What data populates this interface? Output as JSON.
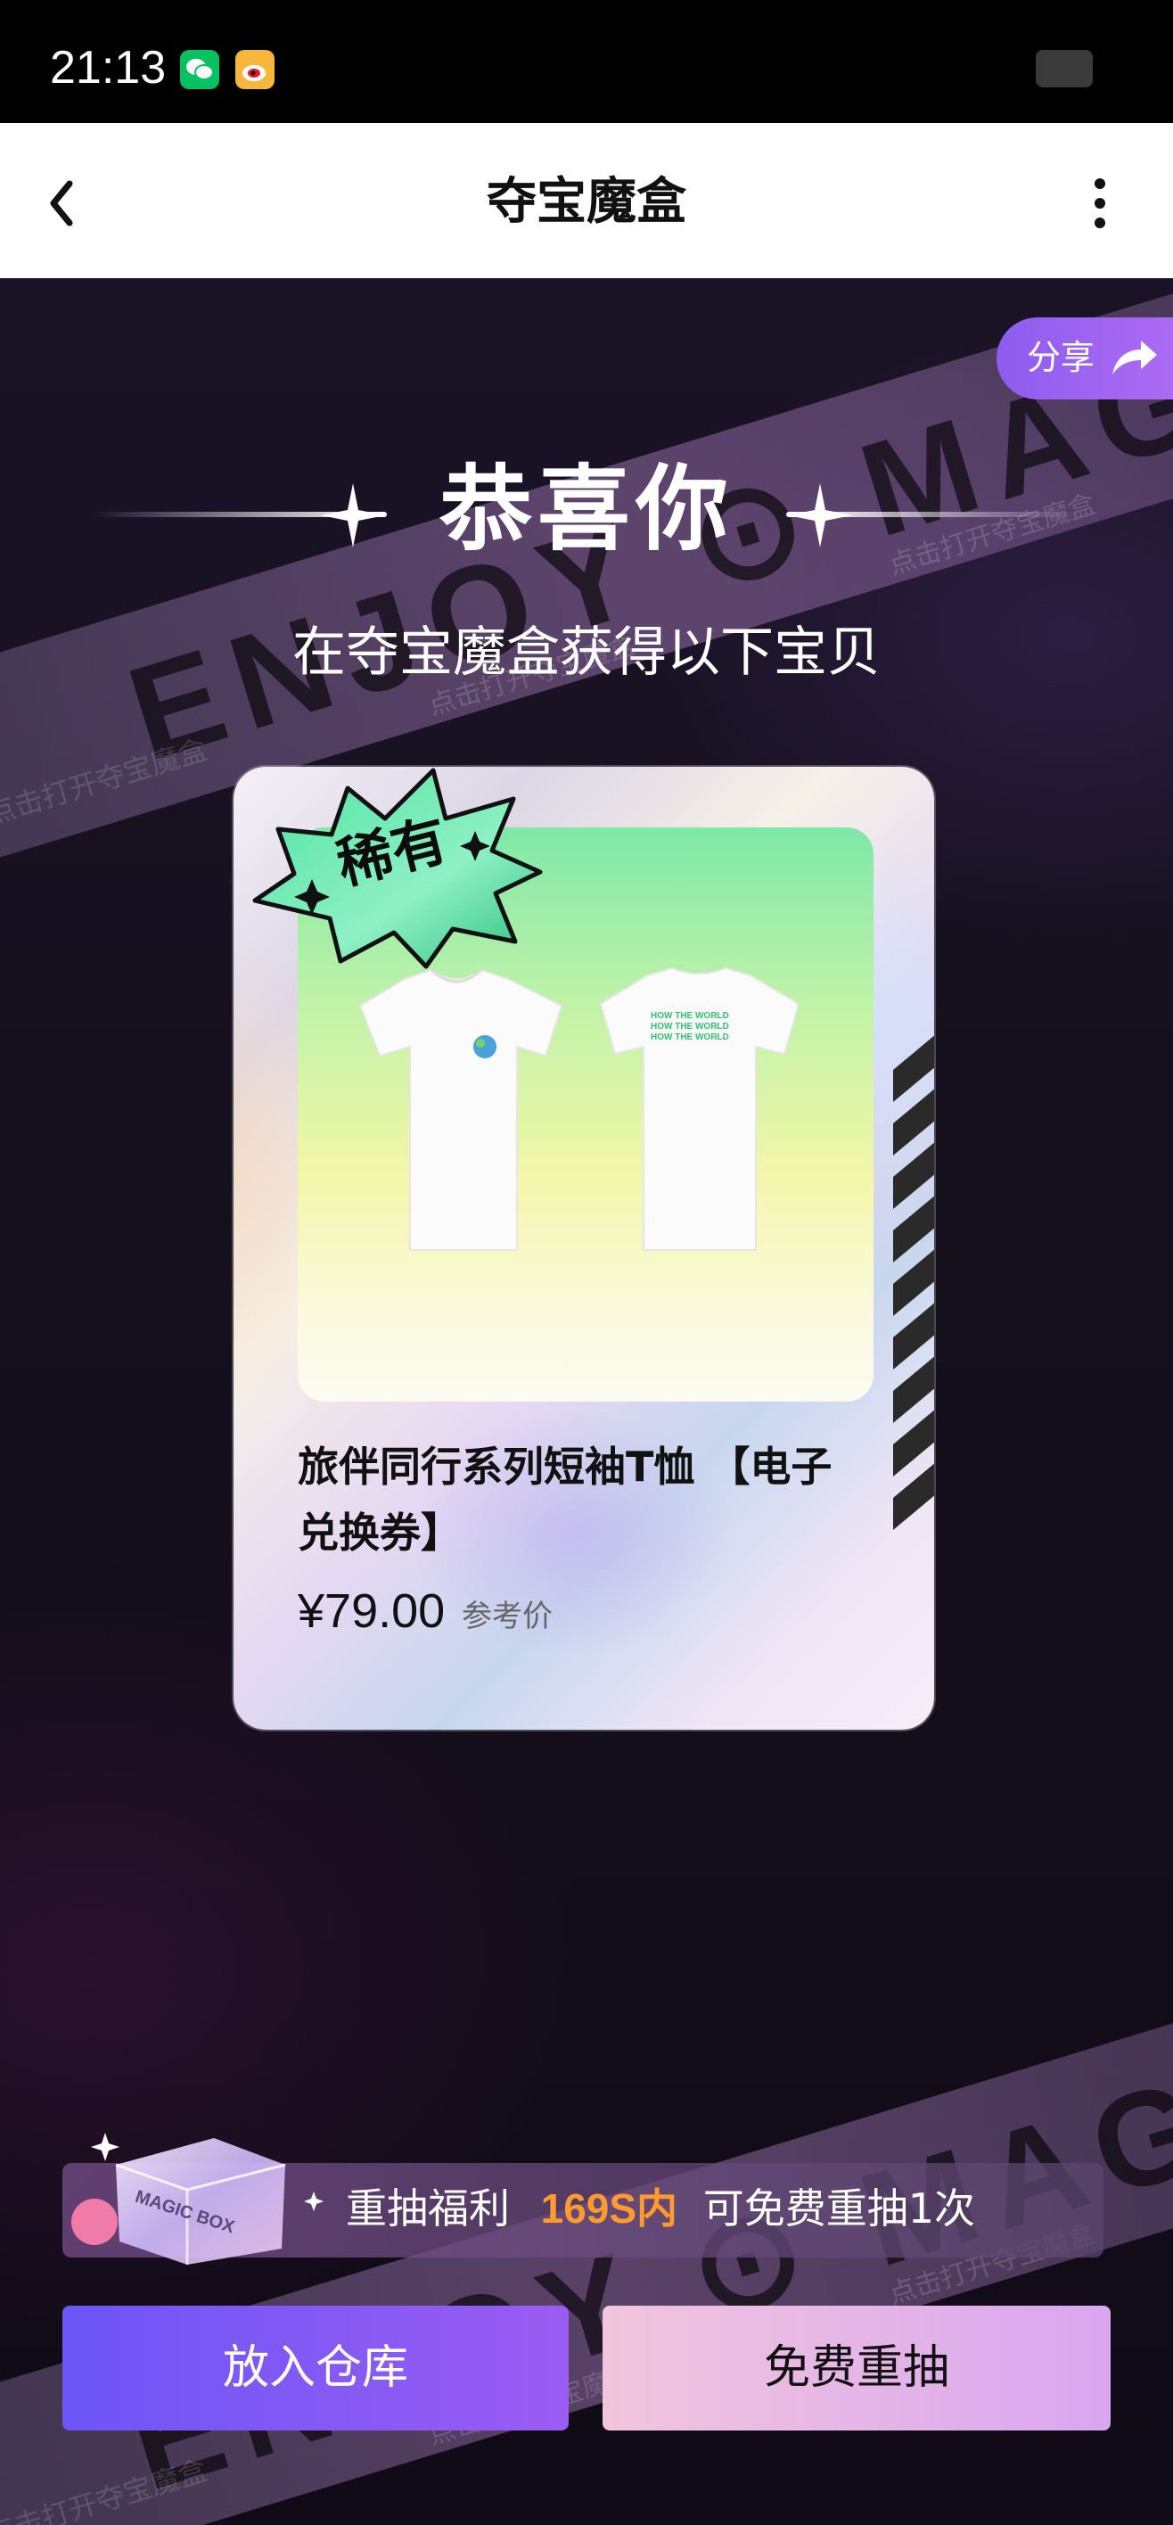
{
  "status_bar": {
    "time": "21:13",
    "apps": [
      "wechat-icon",
      "weibo-icon"
    ]
  },
  "nav": {
    "title": "夺宝魔盒",
    "back_icon": "chevron-left-icon",
    "more_icon": "more-vertical-icon"
  },
  "banner": {
    "text_1": "ENJOY ⊙ MAGIC BOX",
    "text_2": "ENJOY ⊙ MAGIC BOX",
    "watermark": "点击打开夺宝魔盒"
  },
  "share": {
    "label": "分享",
    "icon": "share-arrow-icon"
  },
  "congrats": {
    "title": "恭喜你",
    "subtitle": "在夺宝魔盒获得以下宝贝"
  },
  "prize": {
    "rarity": "稀有",
    "shirt_print": "HOW THE WORLD",
    "name": "旅伴同行系列短袖T恤 【电子兑换券】",
    "price": "¥79.00",
    "price_note": "参考价"
  },
  "reroll": {
    "label": "重抽福利",
    "time": "169S内",
    "detail": "可免费重抽1次",
    "box_label": "MAGIC BOX"
  },
  "actions": {
    "store_label": "放入仓库",
    "reroll_label": "免费重抽"
  },
  "colors": {
    "accent_purple": "#7a58f5",
    "highlight_orange": "#ff9a2e",
    "background": "#15101d"
  }
}
